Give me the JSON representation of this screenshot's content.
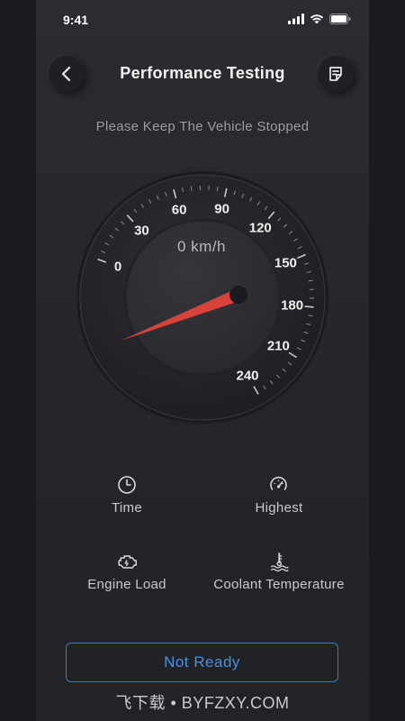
{
  "status_bar": {
    "time": "9:41",
    "icons": [
      "signal-icon",
      "wifi-icon",
      "battery-icon"
    ]
  },
  "header": {
    "title": "Performance Testing",
    "back_icon": "back-chevron-icon",
    "note_icon": "note-icon"
  },
  "subtitle": "Please Keep The Vehicle Stopped",
  "gauge": {
    "speed_readout": "0 km/h",
    "current_speed": 0,
    "max_speed": 240,
    "scale_labels": [
      "0",
      "30",
      "60",
      "90",
      "120",
      "150",
      "180",
      "210",
      "240"
    ],
    "needle_color": "#d9423a"
  },
  "stats": [
    {
      "label": "Time",
      "icon": "clock-icon"
    },
    {
      "label": "Highest",
      "icon": "speedometer-icon"
    },
    {
      "label": "Engine Load",
      "icon": "engine-icon"
    },
    {
      "label": "Coolant Temperature",
      "icon": "coolant-temperature-icon"
    }
  ],
  "ready_button": {
    "label": "Not Ready",
    "color": "#4c8fe0"
  },
  "watermark": "飞下载 • BYFZXY.COM"
}
